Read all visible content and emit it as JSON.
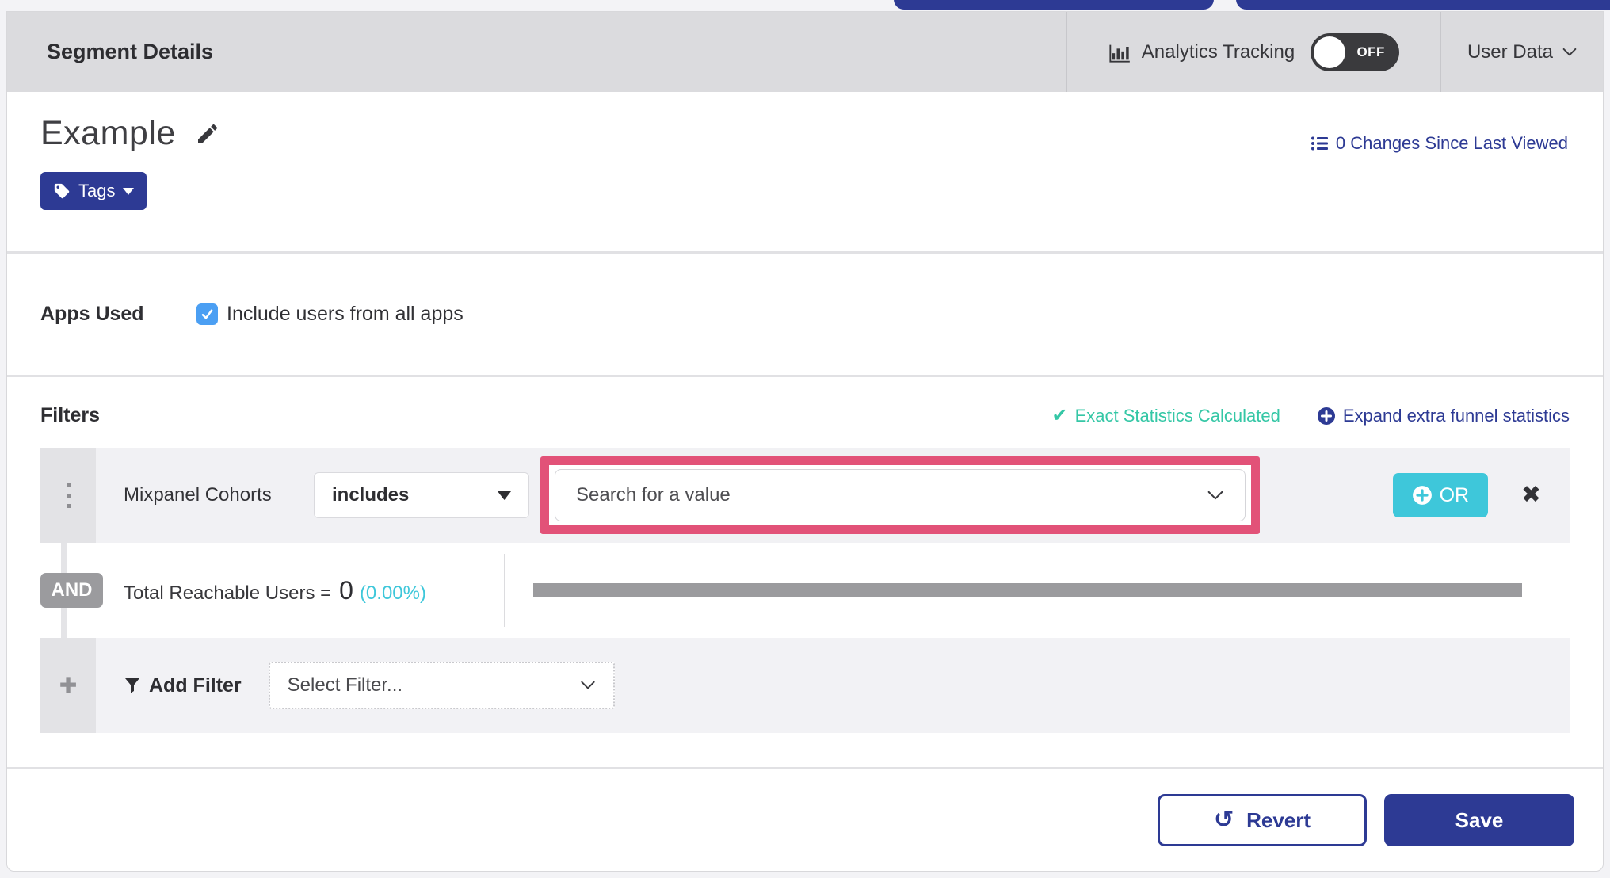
{
  "colors": {
    "navy": "#2d3a94",
    "teal_cyan": "#3ec7da",
    "green": "#35c7a6",
    "highlight_pink": "#e25278",
    "checkbox_blue": "#4b9ff3",
    "badge_gray": "#9b9b9e"
  },
  "top_bar": {
    "title": "Segment Details",
    "analytics_tracking": {
      "label": "Analytics Tracking",
      "toggle_state": "OFF"
    },
    "user_data": {
      "label": "User Data"
    }
  },
  "segment": {
    "name": "Example",
    "changes_link": "0 Changes Since Last Viewed",
    "tags_button": "Tags"
  },
  "apps_used": {
    "label": "Apps Used",
    "checkbox_label": "Include users from all apps",
    "checked": true
  },
  "filters": {
    "heading": "Filters",
    "exact_statistics": "Exact Statistics Calculated",
    "expand_funnel": "Expand extra funnel statistics",
    "row": {
      "field": "Mixpanel Cohorts",
      "operator": "includes",
      "value_placeholder": "Search for a value",
      "or_button": "OR"
    },
    "and_label": "AND",
    "reachable": {
      "label": "Total Reachable Users =",
      "value": "0",
      "percent": "(0.00%)"
    },
    "add_filter": {
      "label": "Add Filter",
      "placeholder": "Select Filter..."
    }
  },
  "footer": {
    "revert": "Revert",
    "save": "Save"
  }
}
